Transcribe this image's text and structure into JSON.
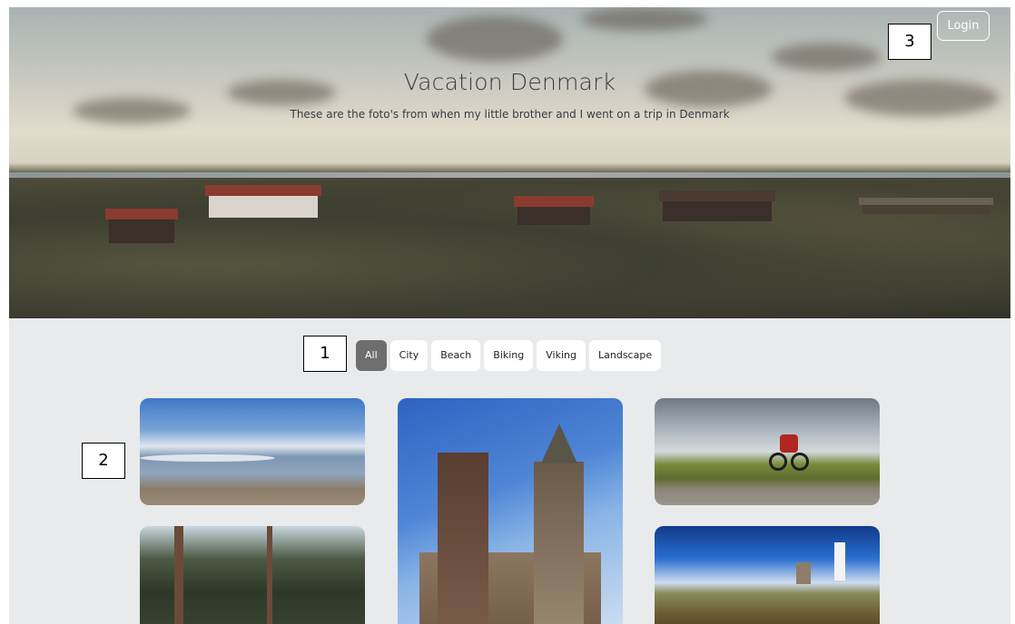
{
  "hero": {
    "title": "Vacation Denmark",
    "subtitle": "These are the foto's from when my little brother and I went on a trip in Denmark",
    "login_label": "Login"
  },
  "filters": {
    "items": [
      {
        "label": "All",
        "active": true
      },
      {
        "label": "City",
        "active": false
      },
      {
        "label": "Beach",
        "active": false
      },
      {
        "label": "Biking",
        "active": false
      },
      {
        "label": "Viking",
        "active": false
      },
      {
        "label": "Landscape",
        "active": false
      }
    ]
  },
  "annotations": {
    "a1": "1",
    "a2": "2",
    "a3": "3"
  },
  "gallery": {
    "photos": [
      "beach-photo",
      "church-photo",
      "cyclist-photo",
      "forest-photo",
      "lighthouse-photo"
    ]
  },
  "colors": {
    "active_filter_bg": "#6e6e6e",
    "content_bg": "#e9eaec"
  }
}
